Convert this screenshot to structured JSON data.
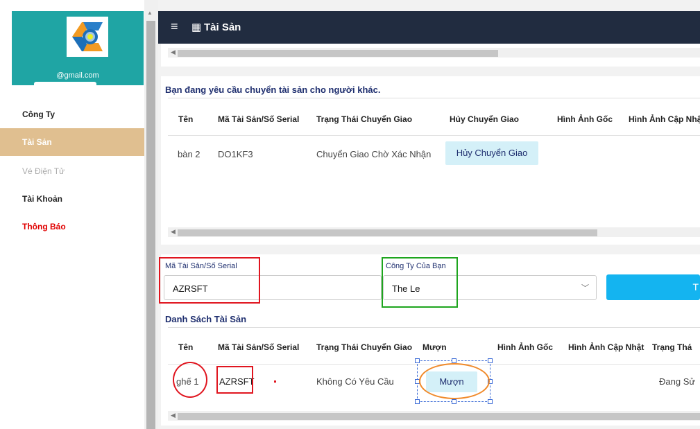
{
  "sidebar": {
    "email": "@gmail.com",
    "items": [
      {
        "label": "Công Ty"
      },
      {
        "label": "Tài Sản"
      },
      {
        "label": "Vé Điện Tử"
      },
      {
        "label": "Tài Khoản"
      },
      {
        "label": "Thông Báo"
      }
    ]
  },
  "header": {
    "title": "Tài Sản",
    "menu_icon": "hamburger-icon",
    "title_icon": "building-icon"
  },
  "transfer": {
    "heading": "Bạn đang yêu cầu chuyển tài sản cho người khác.",
    "columns": [
      "Tên",
      "Mã Tài Sản/Số Serial",
      "Trạng Thái Chuyển Giao",
      "Hủy Chuyển Giao",
      "Hình Ảnh Gốc",
      "Hình Ảnh Cập Nhậ"
    ],
    "row": {
      "name": "bàn 2",
      "serial": "DO1KF3",
      "status": "Chuyển Giao Chờ Xác Nhận",
      "action": "Hủy Chuyển Giao"
    }
  },
  "filters": {
    "serial_label": "Mã Tài Sản/Số Serial",
    "serial_value": "AZRSFT",
    "company_label": "Công Ty Của Bạn",
    "company_value": "The Le",
    "search_button_partial": "T"
  },
  "assets": {
    "heading": "Danh Sách Tài Sản",
    "columns": [
      "Tên",
      "Mã Tài Sản/Số Serial",
      "Trạng Thái Chuyển Giao",
      "Mượn",
      "Hình Ảnh Gốc",
      "Hình Ảnh Cập Nhật",
      "Trạng Thá"
    ],
    "row": {
      "name": "ghế 1",
      "serial": "AZRSFT",
      "status": "Không Có Yêu Cầu",
      "action": "Mượn",
      "state": "Đang Sử"
    }
  },
  "colors": {
    "topbar": "#212c40",
    "sidebar_head": "#1fa5a4",
    "active_nav": "#e0bf90",
    "notification": "#e00000",
    "primary_button": "#14b4f0"
  }
}
